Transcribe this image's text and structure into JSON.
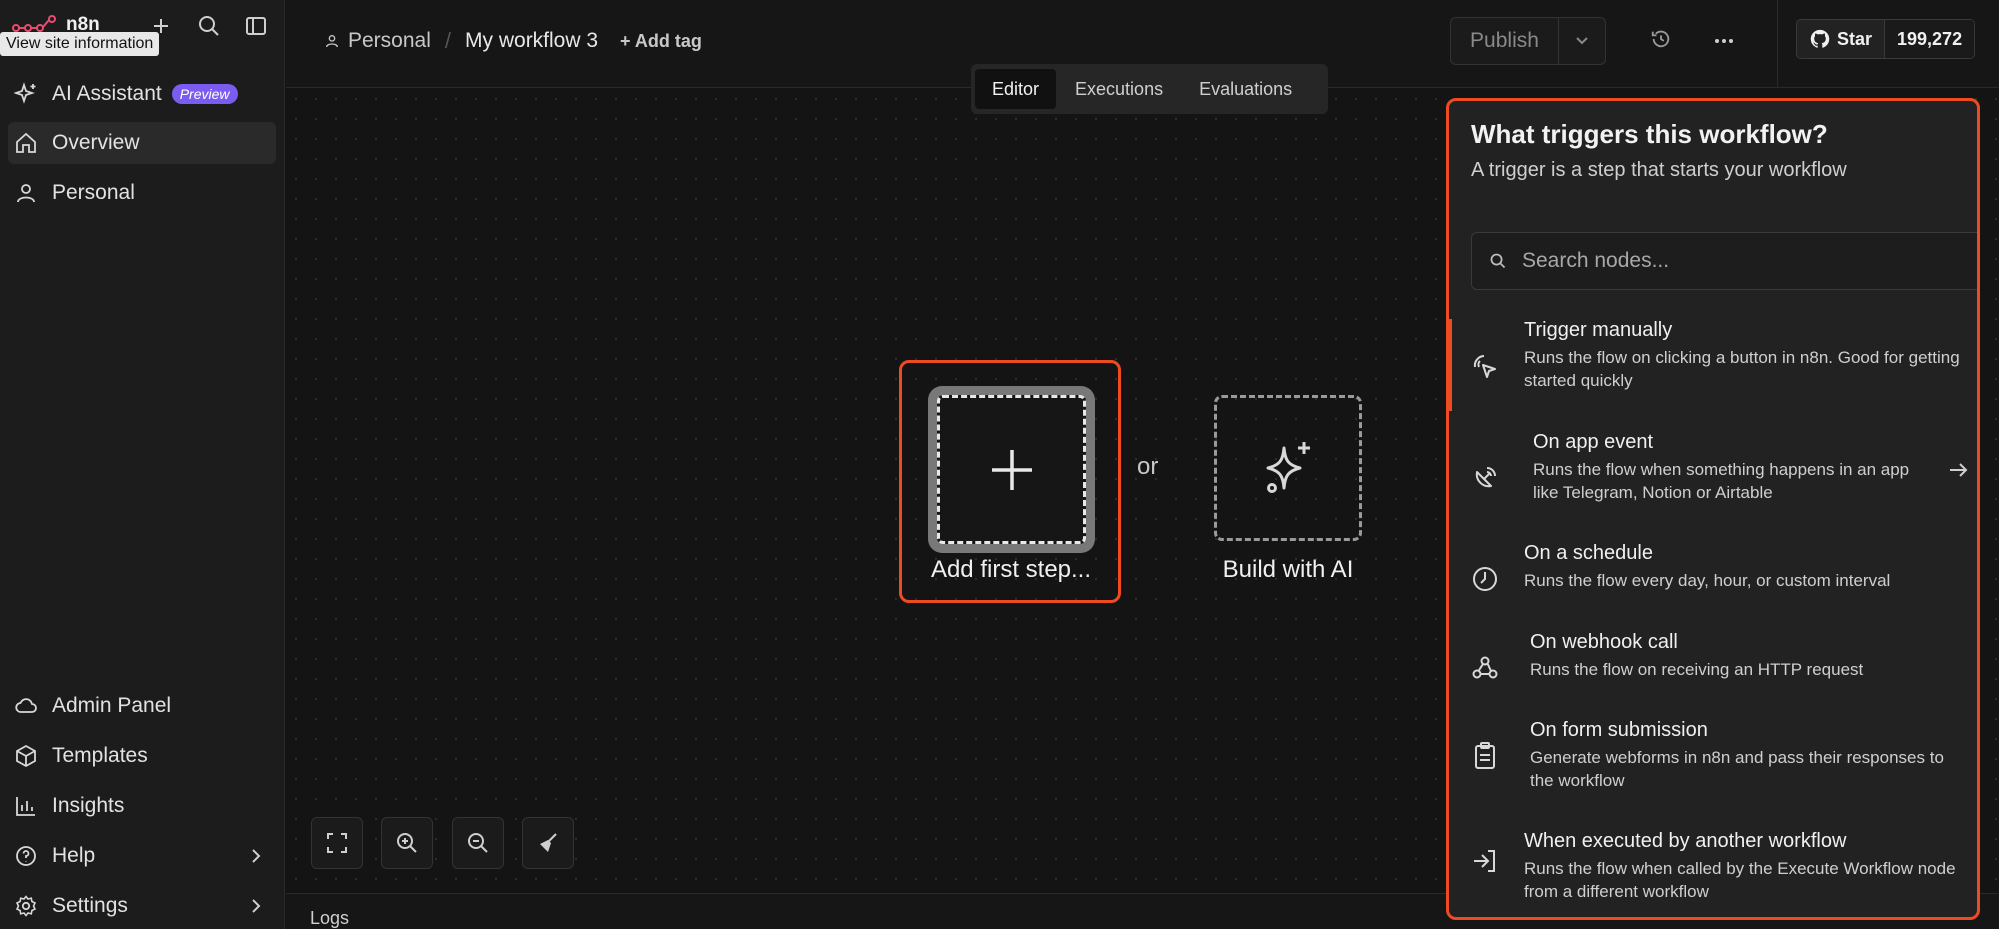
{
  "sidebar": {
    "logo_text": "n8n",
    "tooltip": "View site information",
    "top_items": [
      {
        "label": "AI Assistant",
        "badge": "Preview",
        "icon": "sparkle-icon"
      },
      {
        "label": "Overview",
        "icon": "home-icon"
      },
      {
        "label": "Personal",
        "icon": "user-icon"
      }
    ],
    "bottom_items": [
      {
        "label": "Admin Panel",
        "icon": "cloud-icon"
      },
      {
        "label": "Templates",
        "icon": "box-icon"
      },
      {
        "label": "Insights",
        "icon": "bar-chart-icon"
      },
      {
        "label": "Help",
        "icon": "help-icon"
      },
      {
        "label": "Settings",
        "icon": "gear-icon"
      }
    ]
  },
  "header": {
    "breadcrumb_owner": "Personal",
    "workflow_name": "My workflow 3",
    "add_tag": "+ Add tag",
    "publish": "Publish",
    "star_label": "Star",
    "star_count": "199,272"
  },
  "tabs": [
    {
      "label": "Editor",
      "active": true
    },
    {
      "label": "Executions",
      "active": false
    },
    {
      "label": "Evaluations",
      "active": false
    }
  ],
  "canvas": {
    "add_first_step": "Add first step...",
    "or": "or",
    "build_with_ai": "Build with AI",
    "logs": "Logs"
  },
  "panel": {
    "title": "What triggers this workflow?",
    "subtitle": "A trigger is a step that starts your workflow",
    "search_placeholder": "Search nodes...",
    "triggers": [
      {
        "title": "Trigger manually",
        "desc": "Runs the flow on clicking a button in n8n. Good for getting started quickly",
        "icon": "pointer-click-icon"
      },
      {
        "title": "On app event",
        "desc": "Runs the flow when something happens in an app like Telegram, Notion or Airtable",
        "icon": "satellite-dish-icon"
      },
      {
        "title": "On a schedule",
        "desc": "Runs the flow every day, hour, or custom interval",
        "icon": "clock-icon"
      },
      {
        "title": "On webhook call",
        "desc": "Runs the flow on receiving an HTTP request",
        "icon": "webhook-icon"
      },
      {
        "title": "On form submission",
        "desc": "Generate webforms in n8n and pass their responses to the workflow",
        "icon": "clipboard-icon"
      },
      {
        "title": "When executed by another workflow",
        "desc": "Runs the flow when called by the Execute Workflow node from a different workflow",
        "icon": "sign-in-icon"
      }
    ]
  },
  "colors": {
    "accent": "#ef4b23",
    "badge": "#7b5cf0",
    "background": "#141414"
  }
}
